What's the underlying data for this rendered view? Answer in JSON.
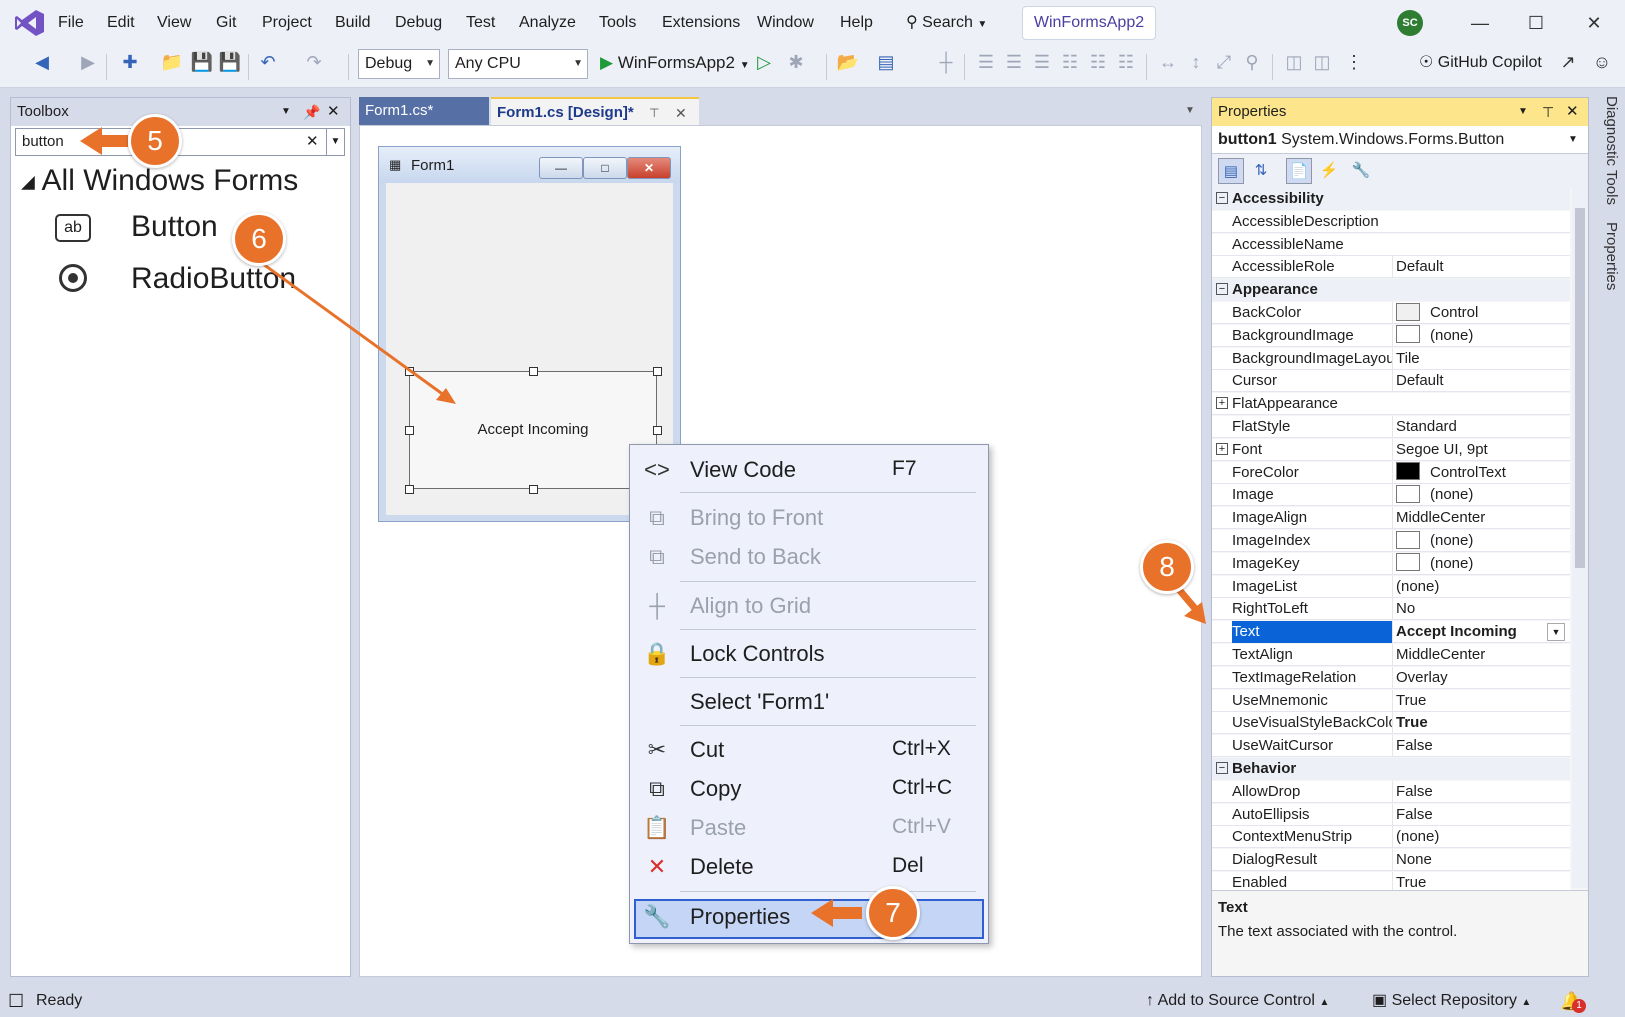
{
  "menubar": {
    "items": [
      "File",
      "Edit",
      "View",
      "Git",
      "Project",
      "Build",
      "Debug",
      "Test",
      "Analyze",
      "Tools",
      "Extensions",
      "Window",
      "Help"
    ],
    "search_label": "Search",
    "solution_name": "WinFormsApp2",
    "avatar_initials": "SC"
  },
  "toolbar": {
    "config": "Debug",
    "platform": "Any CPU",
    "run_target": "WinFormsApp2",
    "copilot_label": "GitHub Copilot"
  },
  "toolbox": {
    "title": "Toolbox",
    "search_value": "button",
    "group": "All Windows Forms",
    "items": [
      {
        "label": "Button",
        "icon": "ab"
      },
      {
        "label": "RadioButton",
        "icon": "radio"
      }
    ]
  },
  "editor": {
    "tabs": [
      {
        "label": "Form1.cs*",
        "active": false
      },
      {
        "label": "Form1.cs [Design]*",
        "active": true
      }
    ],
    "form_title": "Form1",
    "button_text": "Accept Incoming"
  },
  "context_menu": {
    "items": [
      {
        "label": "View Code",
        "shortcut": "F7",
        "enabled": true
      },
      {
        "label": "Bring to Front",
        "shortcut": "",
        "enabled": false
      },
      {
        "label": "Send to Back",
        "shortcut": "",
        "enabled": false
      },
      {
        "label": "Align to Grid",
        "shortcut": "",
        "enabled": false
      },
      {
        "label": "Lock Controls",
        "shortcut": "",
        "enabled": true
      },
      {
        "label": "Select 'Form1'",
        "shortcut": "",
        "enabled": true
      },
      {
        "label": "Cut",
        "shortcut": "Ctrl+X",
        "enabled": true
      },
      {
        "label": "Copy",
        "shortcut": "Ctrl+C",
        "enabled": true
      },
      {
        "label": "Paste",
        "shortcut": "Ctrl+V",
        "enabled": false
      },
      {
        "label": "Delete",
        "shortcut": "Del",
        "enabled": true
      },
      {
        "label": "Properties",
        "shortcut": "",
        "enabled": true
      }
    ]
  },
  "properties": {
    "title": "Properties",
    "object_name": "button1",
    "object_type": "System.Windows.Forms.Button",
    "categories": [
      {
        "name": "Accessibility",
        "rows": [
          {
            "name": "AccessibleDescription",
            "value": ""
          },
          {
            "name": "AccessibleName",
            "value": ""
          },
          {
            "name": "AccessibleRole",
            "value": "Default"
          }
        ]
      },
      {
        "name": "Appearance",
        "rows": [
          {
            "name": "BackColor",
            "value": "Control",
            "swatch": "#f0f0f0"
          },
          {
            "name": "BackgroundImage",
            "value": "(none)",
            "swatch": "#ffffff"
          },
          {
            "name": "BackgroundImageLayout",
            "value": "Tile"
          },
          {
            "name": "Cursor",
            "value": "Default"
          },
          {
            "name": "FlatAppearance",
            "value": "",
            "expandable": true
          },
          {
            "name": "FlatStyle",
            "value": "Standard"
          },
          {
            "name": "Font",
            "value": "Segoe UI, 9pt",
            "expandable": true
          },
          {
            "name": "ForeColor",
            "value": "ControlText",
            "swatch": "#000000"
          },
          {
            "name": "Image",
            "value": "(none)",
            "swatch": "#ffffff"
          },
          {
            "name": "ImageAlign",
            "value": "MiddleCenter"
          },
          {
            "name": "ImageIndex",
            "value": "(none)",
            "swatch": "#ffffff"
          },
          {
            "name": "ImageKey",
            "value": "(none)",
            "swatch": "#ffffff"
          },
          {
            "name": "ImageList",
            "value": "(none)"
          },
          {
            "name": "RightToLeft",
            "value": "No"
          },
          {
            "name": "Text",
            "value": "Accept Incoming",
            "selected": true
          },
          {
            "name": "TextAlign",
            "value": "MiddleCenter"
          },
          {
            "name": "TextImageRelation",
            "value": "Overlay"
          },
          {
            "name": "UseMnemonic",
            "value": "True"
          },
          {
            "name": "UseVisualStyleBackColor",
            "value": "True",
            "bold": true
          },
          {
            "name": "UseWaitCursor",
            "value": "False"
          }
        ]
      },
      {
        "name": "Behavior",
        "rows": [
          {
            "name": "AllowDrop",
            "value": "False"
          },
          {
            "name": "AutoEllipsis",
            "value": "False"
          },
          {
            "name": "ContextMenuStrip",
            "value": "(none)"
          },
          {
            "name": "DialogResult",
            "value": "None"
          },
          {
            "name": "Enabled",
            "value": "True"
          }
        ]
      }
    ],
    "desc_title": "Text",
    "desc_text": "The text associated with the control."
  },
  "side_tabs": [
    "Diagnostic Tools",
    "Properties"
  ],
  "status": {
    "ready": "Ready",
    "source_control": "Add to Source Control",
    "repository": "Select Repository",
    "notifications": "1"
  },
  "callouts": [
    "5",
    "6",
    "7",
    "8"
  ],
  "colors": {
    "accent": "#0a64d8",
    "callout": "#e8722a",
    "properties_title": "#fde58c"
  }
}
